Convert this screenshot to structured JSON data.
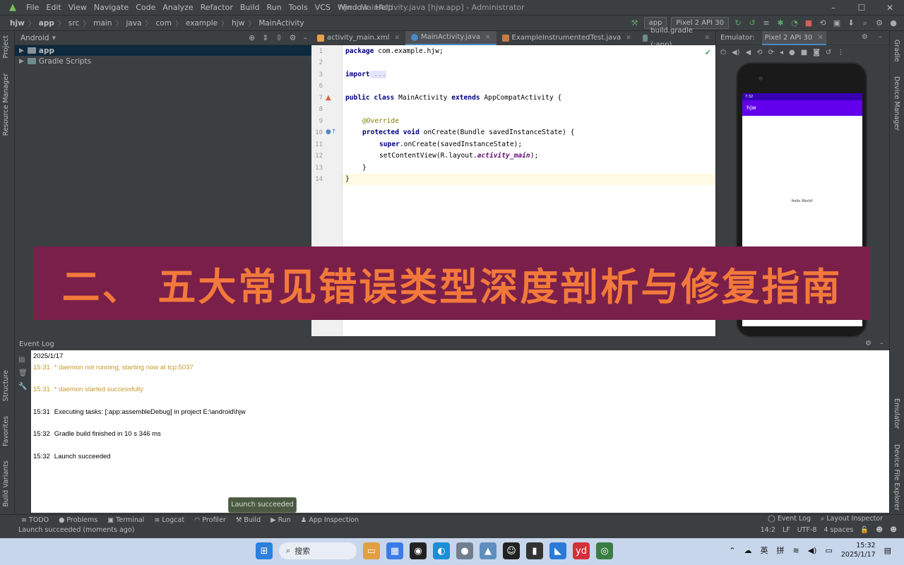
{
  "window": {
    "title": "hjw - MainActivity.java [hjw.app] - Administrator",
    "menu": [
      "File",
      "Edit",
      "View",
      "Navigate",
      "Code",
      "Analyze",
      "Refactor",
      "Build",
      "Run",
      "Tools",
      "VCS",
      "Window",
      "Help"
    ]
  },
  "breadcrumbs": [
    "hjw",
    "app",
    "src",
    "main",
    "java",
    "com",
    "example",
    "hjw",
    "MainActivity"
  ],
  "toolbar": {
    "run_config": "app",
    "device": "Pixel 2 API 30"
  },
  "project_panel": {
    "view": "Android",
    "items": [
      "app",
      "Gradle Scripts"
    ]
  },
  "left_tool_tabs": [
    "Project",
    "Resource Manager",
    "Structure",
    "Favorites",
    "Build Variants"
  ],
  "right_tool_tabs": [
    "Gradle",
    "Device Manager",
    "Emulator",
    "Device File Explorer"
  ],
  "editor_tabs": [
    {
      "label": "activity_main.xml",
      "type": "xml"
    },
    {
      "label": "MainActivity.java",
      "type": "java",
      "active": true
    },
    {
      "label": "ExampleInstrumentedTest.java",
      "type": "test"
    },
    {
      "label": "build.gradle (:app)",
      "type": "gradle"
    }
  ],
  "code": {
    "line_numbers": [
      "1",
      "2",
      "3",
      "6",
      "7",
      "8",
      "9",
      "10",
      "11",
      "12",
      "13",
      "14"
    ],
    "l1_kw": "package",
    "l1_rest": " com.example.hjw;",
    "l3_kw": "import",
    "l3_fold": " ...",
    "l7_kw1": "public class",
    "l7_mid": " MainActivity ",
    "l7_kw2": "extends",
    "l7_rest": " AppCompatActivity {",
    "l9_ann": "@Override",
    "l10_kw1": "protected void",
    "l10_rest": " onCreate(Bundle savedInstanceState) {",
    "l11_kw": "super",
    "l11_rest": ".onCreate(savedInstanceState);",
    "l12_a": "setContentView(R.layout.",
    "l12_i": "activity_main",
    "l12_b": ");",
    "l13": "}",
    "l14": "}"
  },
  "emulator": {
    "panel_label": "Emulator:",
    "tab": "Pixel 2 API 30",
    "status_time": "7:32",
    "app_title": "hjw",
    "content_text": "Hello World!"
  },
  "banner": {
    "text": "二、 五大常见错误类型深度剖析与修复指南",
    "bg": "#7a1f4a",
    "fg": "#f2793b"
  },
  "event_log": {
    "title": "Event Log",
    "date": "2025/1/17",
    "entries": [
      {
        "time": "15:31",
        "text": "* daemon not running; starting now at tcp:5037",
        "level": "warn"
      },
      {
        "time": "15:31",
        "text": "* daemon started successfully",
        "level": "warn"
      },
      {
        "time": "15:31",
        "text": "Executing tasks: [:app:assembleDebug] in project E:\\android\\hjw",
        "level": "info"
      },
      {
        "time": "15:32",
        "text": "Gradle build finished in 10 s 346 ms",
        "level": "info"
      },
      {
        "time": "15:32",
        "text": "Launch succeeded",
        "level": "info"
      }
    ]
  },
  "toast": "Launch succeeded",
  "bottom_tabs": [
    "TODO",
    "Problems",
    "Terminal",
    "Logcat",
    "Profiler",
    "Build",
    "Run",
    "App Inspection"
  ],
  "bottom_tabs_right": [
    "Event Log",
    "Layout Inspector"
  ],
  "status": {
    "message": "Launch succeeded (moments ago)",
    "position": "14:2",
    "line_sep": "LF",
    "encoding": "UTF-8",
    "indent": "4 spaces"
  },
  "taskbar": {
    "search": "搜索",
    "tray_lang": "英",
    "tray_ime": "拼",
    "time": "15:32",
    "date": "2025/1/17"
  }
}
